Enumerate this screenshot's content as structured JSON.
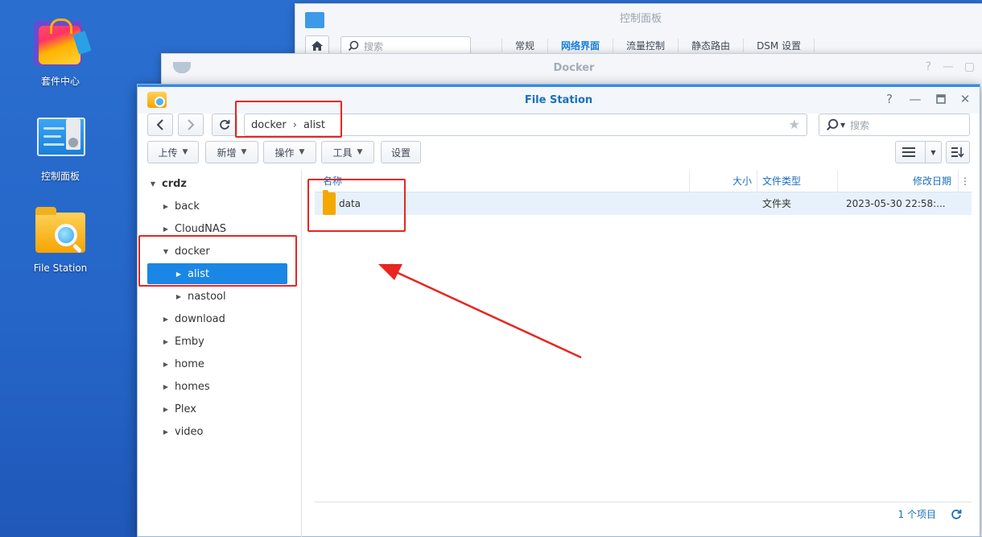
{
  "desktop": {
    "icons": [
      {
        "label": "套件中心",
        "icon": "package-center-icon"
      },
      {
        "label": "控制面板",
        "icon": "control-panel-icon"
      },
      {
        "label": "File Station",
        "icon": "file-station-icon"
      }
    ]
  },
  "control_panel_window": {
    "title": "控制面板",
    "search_placeholder": "搜索",
    "tabs": [
      {
        "label": "常规",
        "active": false
      },
      {
        "label": "网络界面",
        "active": true
      },
      {
        "label": "流量控制",
        "active": false
      },
      {
        "label": "静态路由",
        "active": false
      },
      {
        "label": "DSM 设置",
        "active": false
      }
    ]
  },
  "docker_window": {
    "title": "Docker"
  },
  "file_station": {
    "title": "File Station",
    "path": [
      "docker",
      "alist"
    ],
    "search_placeholder": "搜索",
    "toolbar": {
      "upload": "上传",
      "create": "新增",
      "action": "操作",
      "tools": "工具",
      "settings": "设置"
    },
    "tree": [
      {
        "label": "crdz",
        "level": 0,
        "expanded": true,
        "selected": false
      },
      {
        "label": "back",
        "level": 1,
        "expanded": false,
        "selected": false
      },
      {
        "label": "CloudNAS",
        "level": 1,
        "expanded": false,
        "selected": false
      },
      {
        "label": "docker",
        "level": 1,
        "expanded": true,
        "selected": false
      },
      {
        "label": "alist",
        "level": 2,
        "expanded": false,
        "selected": true
      },
      {
        "label": "nastool",
        "level": 2,
        "expanded": false,
        "selected": false
      },
      {
        "label": "download",
        "level": 1,
        "expanded": false,
        "selected": false
      },
      {
        "label": "Emby",
        "level": 1,
        "expanded": false,
        "selected": false
      },
      {
        "label": "home",
        "level": 1,
        "expanded": false,
        "selected": false
      },
      {
        "label": "homes",
        "level": 1,
        "expanded": false,
        "selected": false
      },
      {
        "label": "Plex",
        "level": 1,
        "expanded": false,
        "selected": false
      },
      {
        "label": "video",
        "level": 1,
        "expanded": false,
        "selected": false
      }
    ],
    "columns": {
      "name": "名称",
      "size": "大小",
      "type": "文件类型",
      "modified": "修改日期"
    },
    "rows": [
      {
        "name": "data",
        "size": "",
        "type": "文件夹",
        "modified": "2023-05-30 22:58:..."
      }
    ],
    "status": "1 个项目"
  },
  "colors": {
    "accent": "#1a86e6",
    "annotation": "#e8251f",
    "desktop": "#2565c8"
  }
}
